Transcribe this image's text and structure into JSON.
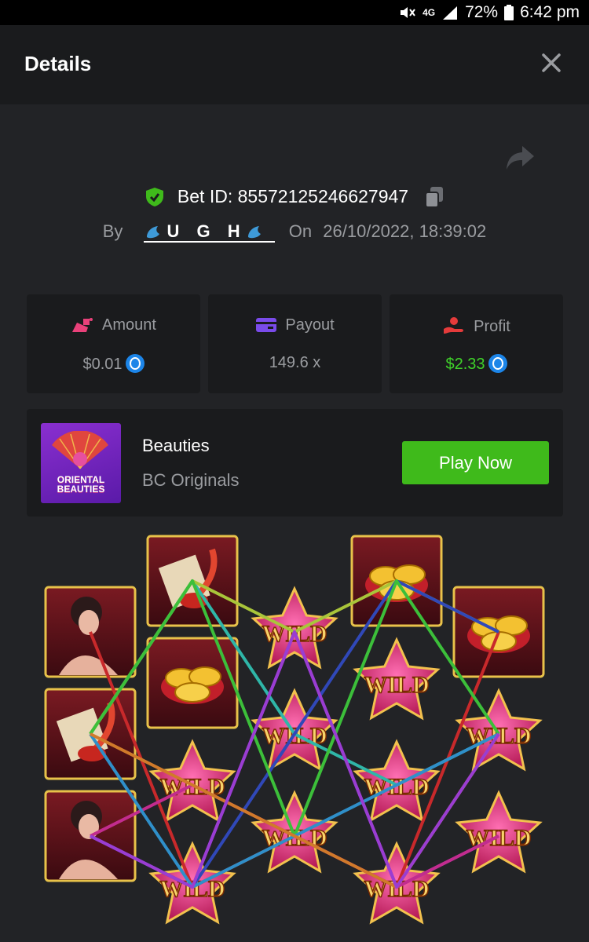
{
  "status_bar": {
    "battery": "72%",
    "time": "6:42 pm",
    "network": "4G"
  },
  "header": {
    "title": "Details"
  },
  "bet": {
    "id_text": "Bet ID: 85572125246627947",
    "by_label": "By",
    "user": "U G H",
    "on_label": "On",
    "datetime": "26/10/2022, 18:39:02"
  },
  "stats": {
    "amount": {
      "label": "Amount",
      "value": "$0.01"
    },
    "payout": {
      "label": "Payout",
      "value": "149.6 x"
    },
    "profit": {
      "label": "Profit",
      "value": "$2.33"
    }
  },
  "game": {
    "name": "Beauties",
    "provider": "BC Originals",
    "thumb_text": "ORIENTAL BEAUTIES",
    "play_label": "Play Now"
  },
  "reels": {
    "symbol_text": "WILD",
    "columns": [
      [
        "lady",
        "scroll",
        "lady2"
      ],
      [
        "scroll",
        "gold",
        "wild",
        "wild"
      ],
      [
        "wild",
        "wild",
        "wild"
      ],
      [
        "gold",
        "wild",
        "wild",
        "wild"
      ],
      [
        "gold",
        "wild",
        "wild"
      ]
    ],
    "line_colors": [
      "#c8292b",
      "#2fb6a8",
      "#a9c53a",
      "#8b2fc2",
      "#3048b8",
      "#3cbf3a",
      "#c22c8e",
      "#2f8fc9",
      "#d07a2a",
      "#9a3dd2"
    ]
  },
  "colors": {
    "accent_green": "#3fba1b",
    "profit_green": "#3fd22a",
    "card_bg": "#1a1b1d",
    "page_bg": "#222326"
  }
}
